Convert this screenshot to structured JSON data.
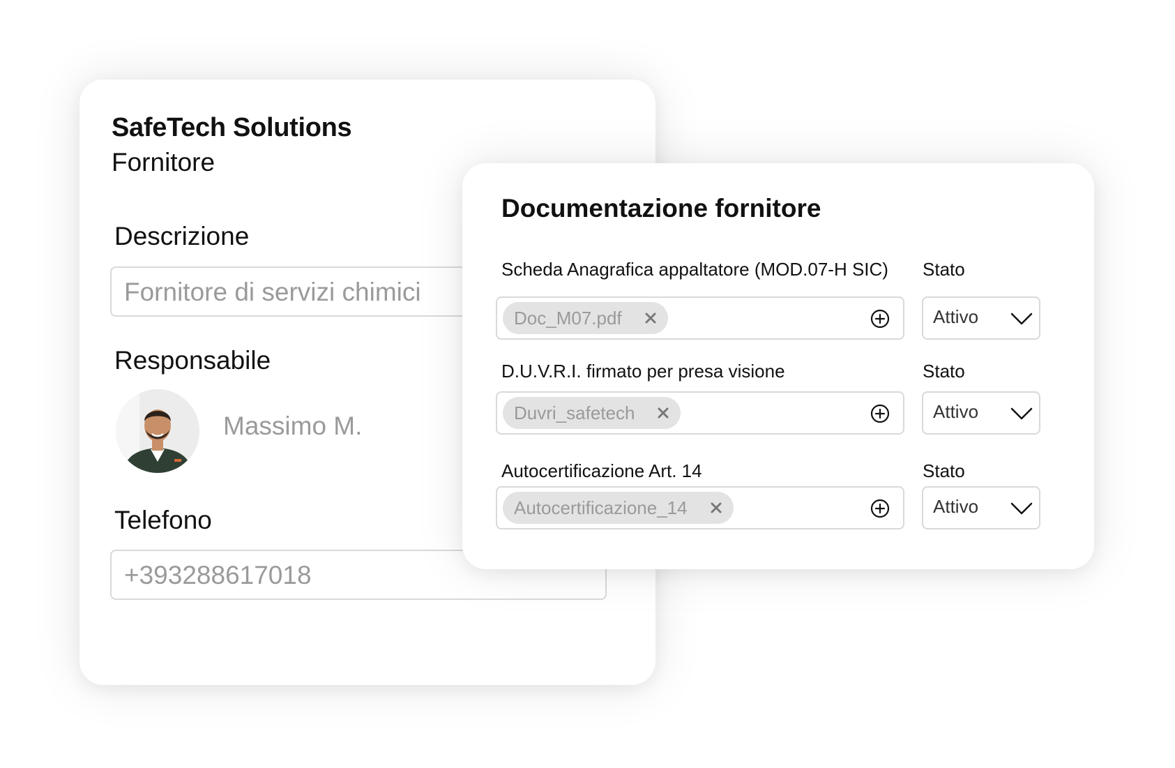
{
  "supplier": {
    "company_name": "SafeTech Solutions",
    "company_role": "Fornitore",
    "description": {
      "label": "Descrizione",
      "value": "Fornitore di servizi chimici"
    },
    "responsible": {
      "label": "Responsabile",
      "name": "Massimo M."
    },
    "phone": {
      "label": "Telefono",
      "value": "+393288617018"
    }
  },
  "documents": {
    "title": "Documentazione fornitore",
    "status_label": "Stato",
    "items": [
      {
        "label": "Scheda Anagrafica appaltatore (MOD.07-H SIC)",
        "file": "Doc_M07.pdf",
        "status": "Attivo"
      },
      {
        "label": "D.U.V.R.I. firmato per presa visione",
        "file": "Duvri_safetech",
        "status": "Attivo"
      },
      {
        "label": "Autocertificazione Art. 14",
        "file": "Autocertificazione_14",
        "status": "Attivo"
      }
    ]
  },
  "icons": {
    "remove_file": "close-icon",
    "add_file": "plus-circle-icon",
    "dropdown": "chevron-down-icon"
  },
  "colors": {
    "placeholder_text": "#9a9a9a",
    "border": "#d9d9d9",
    "chip_background": "#e3e3e3"
  }
}
